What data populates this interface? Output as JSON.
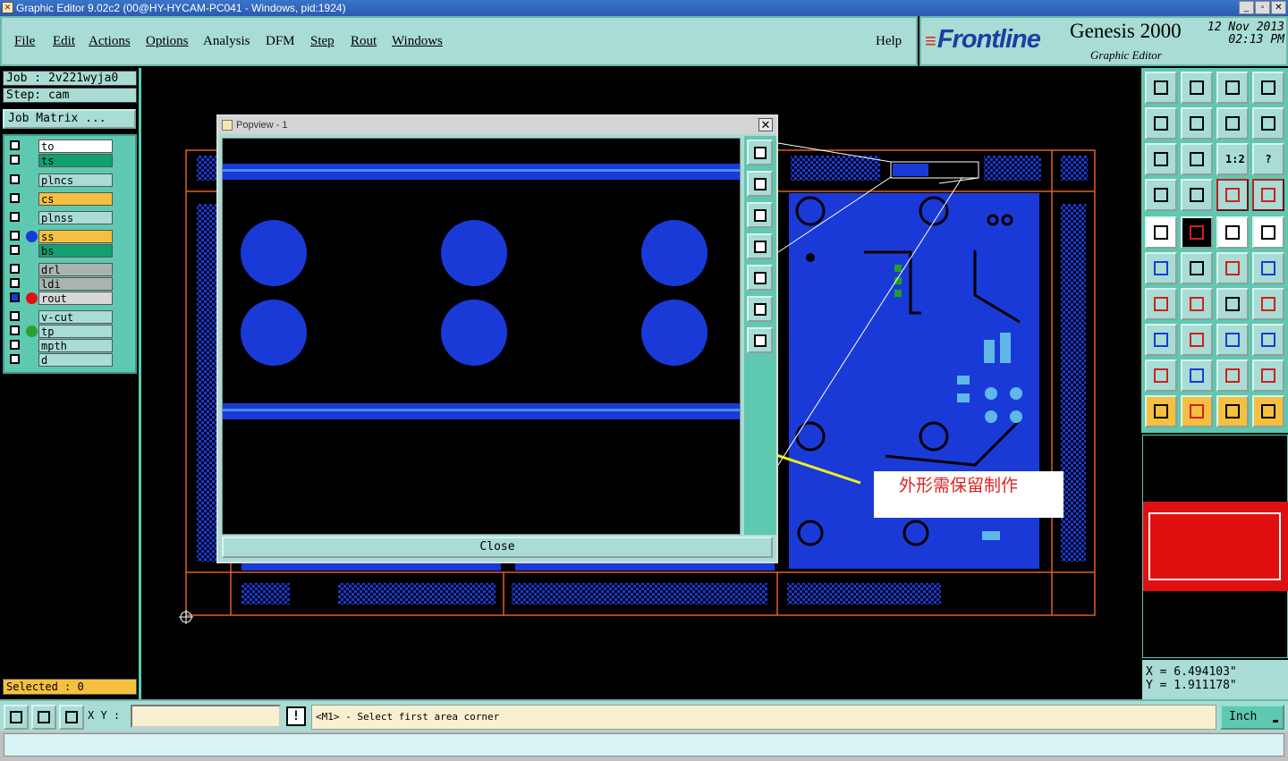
{
  "window": {
    "title": "Graphic Editor 9.02c2 (00@HY-HYCAM-PC041 - Windows, pid:1924)",
    "controls": [
      "_",
      "▫",
      "✕"
    ]
  },
  "menu": {
    "file": "File",
    "edit": "Edit",
    "actions": "Actions",
    "options": "Options",
    "analysis": "Analysis",
    "dfm": "DFM",
    "step": "Step",
    "rout": "Rout",
    "windows": "Windows",
    "help": "Help"
  },
  "brand": {
    "logo": "Frontline",
    "product": "Genesis 2000",
    "subtitle": "Graphic Editor",
    "date": "12 Nov 2013",
    "time": "02:13 PM"
  },
  "job": {
    "name": "Job : 2v221wyja0",
    "step": "Step: cam",
    "matrix_button": "Job Matrix ..."
  },
  "layers": [
    {
      "name": "to",
      "color": "#ffffff",
      "dot": ""
    },
    {
      "name": "ts",
      "color": "#13a070",
      "dot": ""
    },
    {
      "name": "plncs",
      "color": "#a8dcd4",
      "dot": ""
    },
    {
      "name": "cs",
      "color": "#f5c040",
      "dot": ""
    },
    {
      "name": "plnss",
      "color": "#a8dcd4",
      "dot": ""
    },
    {
      "name": "ss",
      "color": "#f5c040",
      "dot": "#1a3ad8"
    },
    {
      "name": "bs",
      "color": "#13a070",
      "dot": ""
    },
    {
      "name": "drl",
      "color": "#a8b4b0",
      "dot": ""
    },
    {
      "name": "ldi",
      "color": "#a8b4b0",
      "dot": ""
    },
    {
      "name": "rout",
      "color": "#d8d8d8",
      "dot": "#e01010"
    },
    {
      "name": "v-cut",
      "color": "#a8dcd4",
      "dot": ""
    },
    {
      "name": "tp",
      "color": "#a8dcd4",
      "dot": "#2aa030"
    },
    {
      "name": "mpth",
      "color": "#a8dcd4",
      "dot": ""
    },
    {
      "name": "d",
      "color": "#a8dcd4",
      "dot": ""
    }
  ],
  "selected": "Selected : 0",
  "popview": {
    "title": "Popview - 1",
    "close_label": "Close"
  },
  "annotation": "外形需保留制作",
  "tools": {
    "scale_label": "1:2",
    "help_label": "?"
  },
  "coords": {
    "x": "X =  6.494103\"",
    "y": "Y =  1.911178\""
  },
  "status": {
    "xy_label": "X Y :",
    "xy_value": "",
    "bang": "!",
    "prompt": "<M1> - Select first area corner",
    "units": "Inch"
  }
}
